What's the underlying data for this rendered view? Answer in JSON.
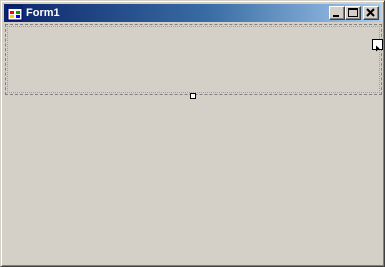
{
  "window": {
    "title": "Form1",
    "icon": "form-app-icon"
  },
  "caption_buttons": {
    "minimize": "minimize-icon",
    "maximize": "maximize-icon",
    "close": "close-icon"
  },
  "designer": {
    "selected_control": "docked-panel",
    "smart_tag": "smart-tag-arrow-icon",
    "resize_handle": "bottom-resize-handle"
  },
  "colors": {
    "face": "#d4d0c8",
    "title_start": "#0a246a",
    "title_end": "#a6caf0",
    "title_text": "#ffffff"
  }
}
